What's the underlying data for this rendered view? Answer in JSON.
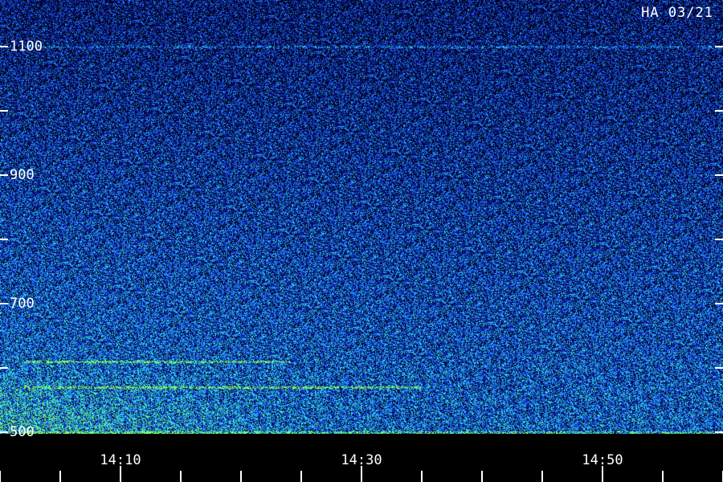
{
  "chart_data": {
    "type": "heatmap",
    "title": "",
    "stamp": "HA 03/21",
    "xlabel": "",
    "ylabel": "",
    "y_ticks": [
      "500",
      "700",
      "900",
      "1100"
    ],
    "y_tick_values": [
      500,
      700,
      900,
      1100
    ],
    "y_minor_values": [
      600,
      800,
      1000
    ],
    "ylim": [
      500,
      1100
    ],
    "x_ticks": [
      "14:10",
      "14:30",
      "14:50"
    ],
    "x_tick_minutes": [
      10,
      30,
      50
    ],
    "xlim_minutes": [
      2,
      61
    ],
    "colormap": [
      "#000010",
      "#0a1a8c",
      "#1a3cff",
      "#1e90ff",
      "#30e0ff",
      "#40ff90",
      "#a0ff40"
    ],
    "background_color": "#000000",
    "tick_color": "#ffffff",
    "horizontal_bands": [
      {
        "y": 610,
        "x_start_min": 2,
        "x_end_min": 24,
        "strength": 0.55
      },
      {
        "y": 570,
        "x_start_min": 2,
        "x_end_min": 35,
        "strength": 0.6
      },
      {
        "y": 500,
        "x_start_min": 2,
        "x_end_min": 60,
        "strength": 0.45
      },
      {
        "y": 1100,
        "x_start_min": 2,
        "x_end_min": 60,
        "strength": 0.25
      }
    ]
  }
}
